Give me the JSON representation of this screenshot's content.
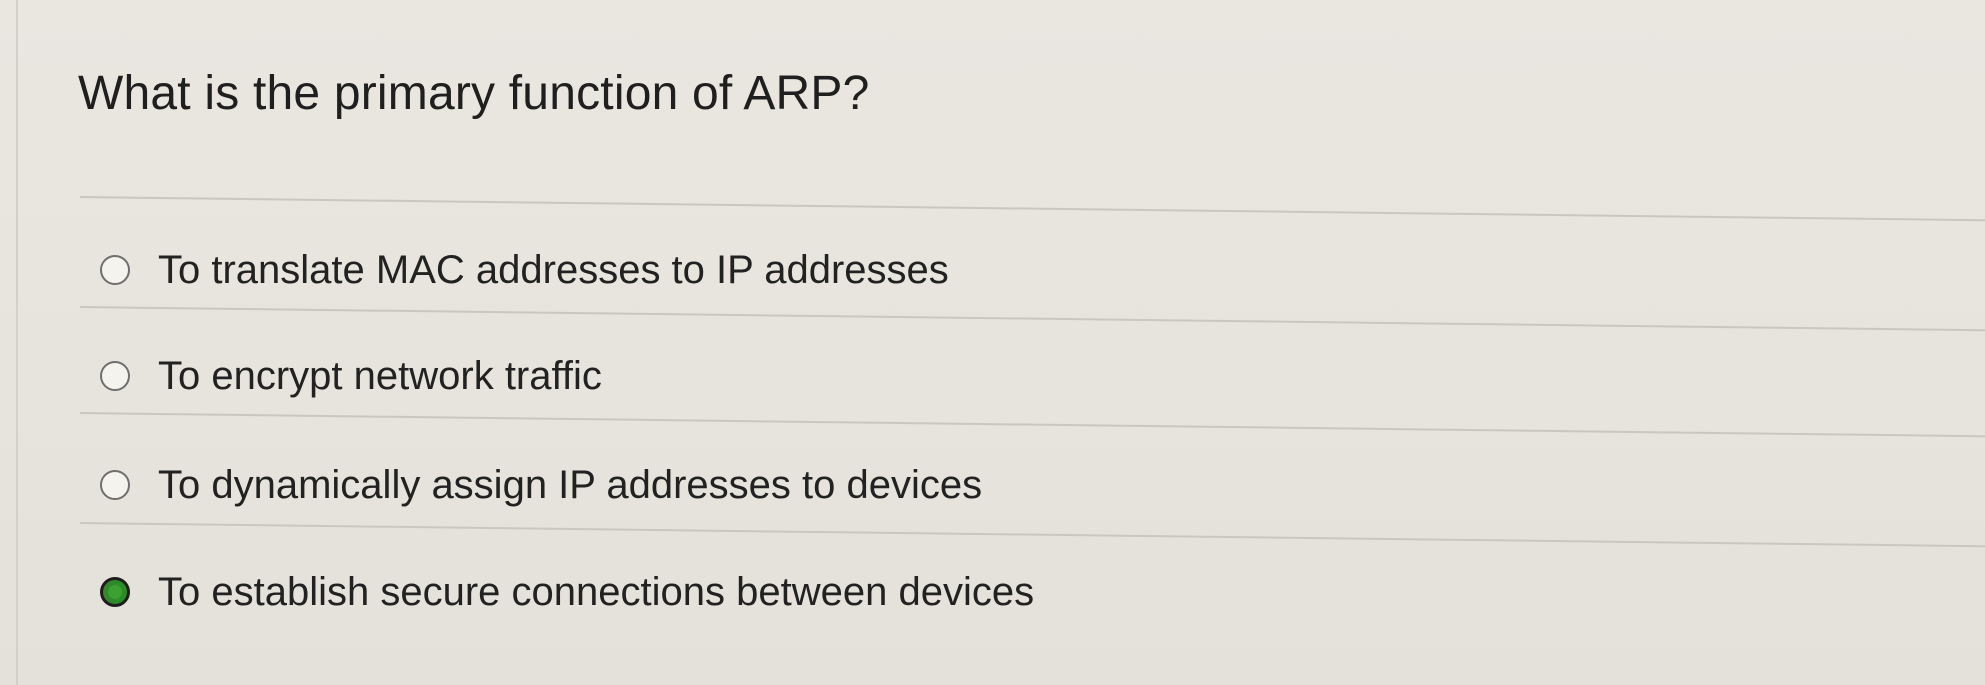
{
  "question": {
    "text": "What is the primary function of ARP?"
  },
  "options": [
    {
      "label": "To translate MAC addresses to IP addresses",
      "selected": false
    },
    {
      "label": "To encrypt network traffic",
      "selected": false
    },
    {
      "label": "To dynamically assign IP addresses to devices",
      "selected": false
    },
    {
      "label": "To establish secure connections between devices",
      "selected": true
    }
  ],
  "colors": {
    "selected_radio": "#2f8a2a",
    "background": "#e7e5de"
  }
}
